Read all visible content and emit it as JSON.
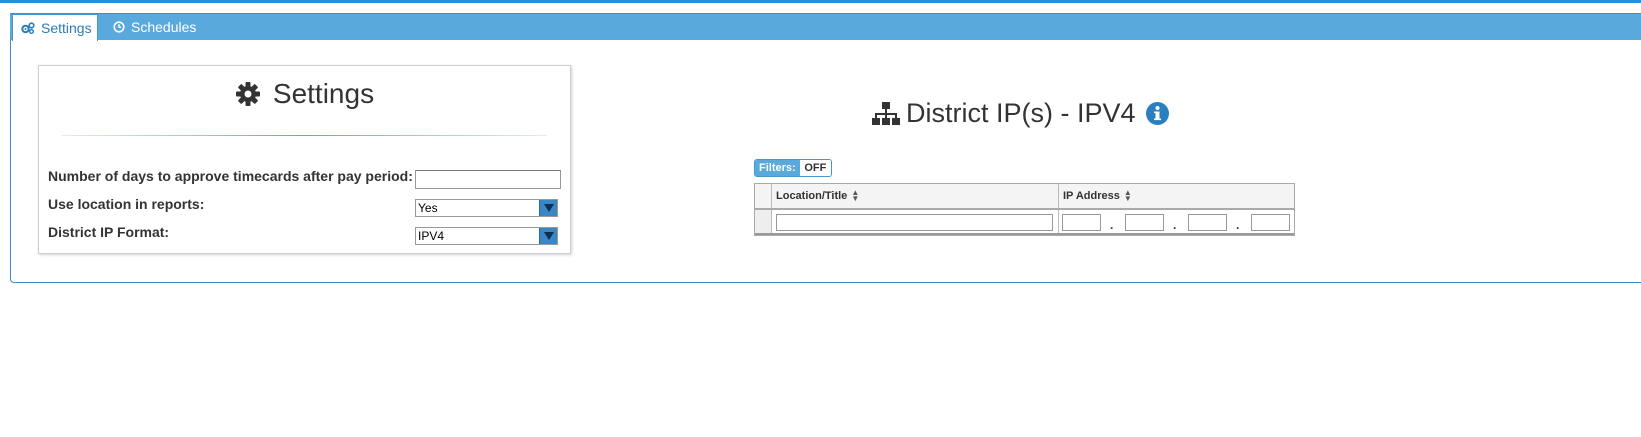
{
  "tabs": [
    {
      "label": "Settings",
      "icon": "gears-icon",
      "active": true
    },
    {
      "label": "Schedules",
      "icon": "clock-icon",
      "active": false
    }
  ],
  "settings_card": {
    "title": "Settings",
    "rows": [
      {
        "label": "Number of days to approve timecards after pay period:",
        "value": ""
      },
      {
        "label": "Use location in reports:",
        "value": "Yes"
      },
      {
        "label": "District IP Format:",
        "value": "IPV4"
      }
    ]
  },
  "district_ip": {
    "title": "District IP(s) - IPV4",
    "filters_label": "Filters:",
    "filters_state": "OFF",
    "columns": [
      "Location/Title",
      "IP Address"
    ],
    "ip_separator": "."
  },
  "colors": {
    "accent": "#59a9dc",
    "dark_accent": "#2a8fd1",
    "select_arrow": "#3b86c4"
  }
}
